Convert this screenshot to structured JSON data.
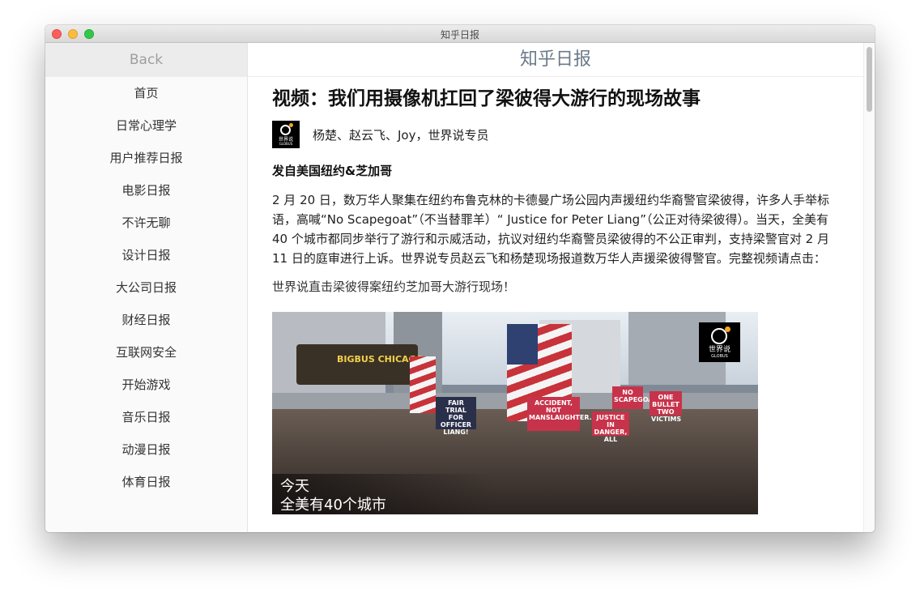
{
  "window": {
    "title": "知乎日报"
  },
  "sidebar": {
    "back_label": "Back",
    "items": [
      {
        "label": "首页"
      },
      {
        "label": "日常心理学"
      },
      {
        "label": "用户推荐日报"
      },
      {
        "label": "电影日报"
      },
      {
        "label": "不许无聊"
      },
      {
        "label": "设计日报"
      },
      {
        "label": "大公司日报"
      },
      {
        "label": "财经日报"
      },
      {
        "label": "互联网安全"
      },
      {
        "label": "开始游戏"
      },
      {
        "label": "音乐日报"
      },
      {
        "label": "动漫日报"
      },
      {
        "label": "体育日报"
      }
    ]
  },
  "main": {
    "header_title": "知乎日报",
    "article": {
      "title": "视频：我们用摄像机扛回了梁彼得大游行的现场故事",
      "authors": "杨楚、赵云飞、Joy，世界说专员",
      "section_heading": "发自美国纽约&芝加哥",
      "body": "2 月 20 日，数万华人聚集在纽约布鲁克林的卡德曼广场公园内声援纽约华裔警官梁彼得，许多人手举标语，高喊“No Scapegoat”（不当替罪羊）“ Justice for Peter Liang”（公正对待梁彼得）。当天，全美有 40 个城市都同步举行了游行和示威活动，抗议对纽约华裔警员梁彼得的不公正审判，支持梁警官对 2 月 11 日的庭审进行上诉。世界说专员赵云飞和杨楚现场报道数万华人声援梁彼得警官。完整视频请点击：",
      "video_link": "世界说直击梁彼得案纽约芝加哥大游行现场！",
      "video": {
        "logo_brand": "世界说",
        "logo_sub": "GLOBUS",
        "bus_text": "BIGBUS CHICAGO",
        "sign_1": "ACCIDENT, NOT MANSLAUGHTER.",
        "sign_2": "FAIR TRIAL FOR OFFICER LIANG!",
        "sign_3": "NO SCAPEGOAT",
        "sign_4": "ONE BULLET TWO VICTIMS",
        "sign_5": "JUSTICE IN DANGER, ALL",
        "caption_line1": "今天",
        "caption_line2": "全美有40个城市"
      }
    }
  },
  "colors": {
    "header_text": "#6b7a8a",
    "sidebar_bg": "#fafafa",
    "back_bg": "#ececec",
    "close": "#fc605c",
    "minimize": "#fdbc40",
    "maximize": "#34c84a"
  }
}
